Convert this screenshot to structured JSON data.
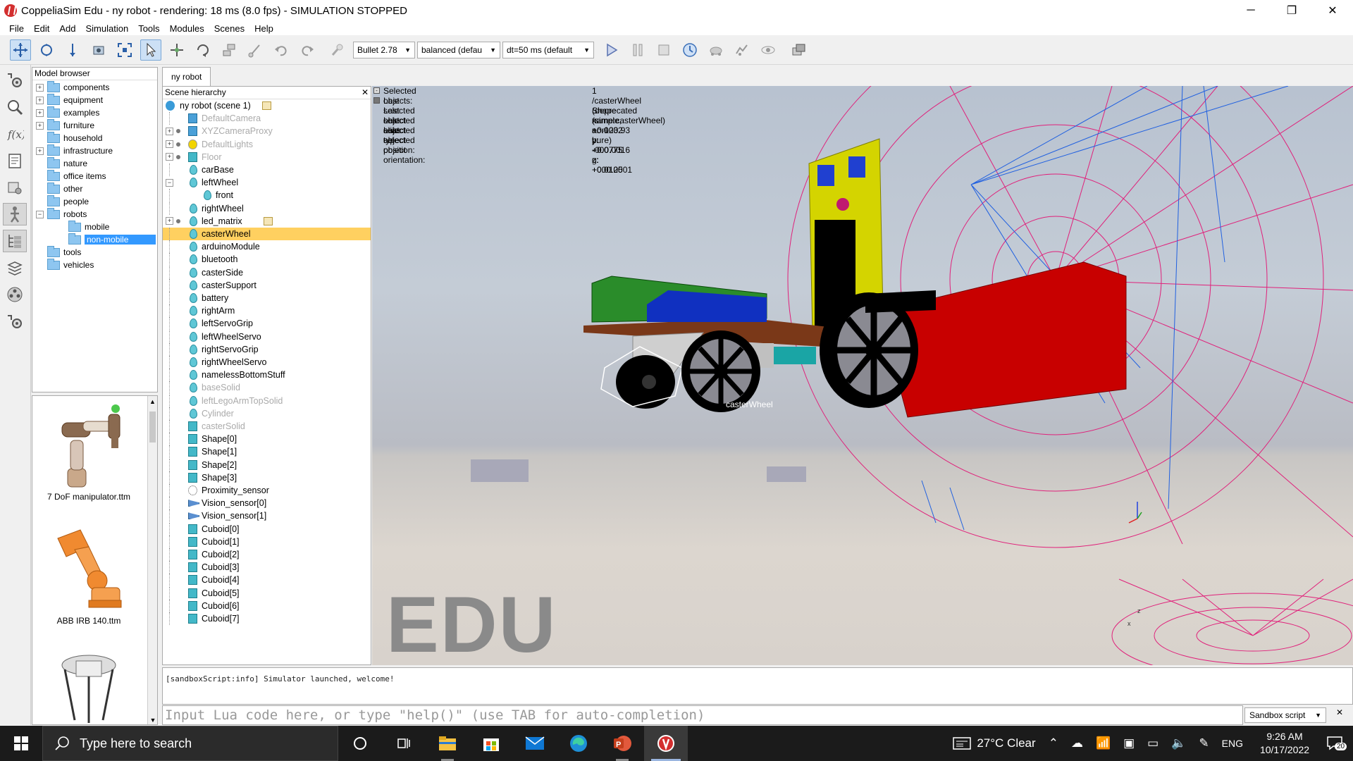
{
  "window": {
    "title": "CoppeliaSim Edu - ny robot - rendering: 18 ms (8.0 fps) - SIMULATION STOPPED",
    "minimize": "─",
    "maximize": "❐",
    "close": "✕"
  },
  "menu": [
    "File",
    "Edit",
    "Add",
    "Simulation",
    "Tools",
    "Modules",
    "Scenes",
    "Help"
  ],
  "toolbar": {
    "engine": "Bullet 2.78",
    "accuracy": "balanced (defau",
    "timestep": "dt=50 ms (default"
  },
  "model_browser": {
    "title": "Model browser",
    "folders": [
      {
        "label": "components",
        "expandable": true
      },
      {
        "label": "equipment",
        "expandable": true
      },
      {
        "label": "examples",
        "expandable": true
      },
      {
        "label": "furniture",
        "expandable": true
      },
      {
        "label": "household",
        "expandable": false
      },
      {
        "label": "infrastructure",
        "expandable": true
      },
      {
        "label": "nature",
        "expandable": false
      },
      {
        "label": "office items",
        "expandable": false
      },
      {
        "label": "other",
        "expandable": false
      },
      {
        "label": "people",
        "expandable": false
      },
      {
        "label": "robots",
        "expandable": true,
        "expanded": true
      },
      {
        "label": "mobile",
        "child": true
      },
      {
        "label": "non-mobile",
        "child": true,
        "selected": true
      },
      {
        "label": "tools",
        "expandable": false
      },
      {
        "label": "vehicles",
        "expandable": false
      }
    ],
    "models": [
      "7 DoF manipulator.ttm",
      "ABB IRB 140.ttm"
    ]
  },
  "scene_tab": "ny robot",
  "scene_hierarchy": {
    "title": "Scene hierarchy",
    "root": "ny robot (scene 1)",
    "items": [
      {
        "label": "DefaultCamera",
        "icon": "camera",
        "gray": true
      },
      {
        "label": "XYZCameraProxy",
        "icon": "camera",
        "gray": true,
        "exp": true
      },
      {
        "label": "DefaultLights",
        "icon": "light",
        "gray": true,
        "exp": true
      },
      {
        "label": "Floor",
        "icon": "cube",
        "gray": true,
        "exp": true
      },
      {
        "label": "carBase",
        "icon": "drop"
      },
      {
        "label": "leftWheel",
        "icon": "drop",
        "exp": true,
        "expanded": true
      },
      {
        "label": "front",
        "icon": "drop",
        "indent": true
      },
      {
        "label": "rightWheel",
        "icon": "drop"
      },
      {
        "label": "led_matrix",
        "icon": "drop",
        "exp": true,
        "tag": true
      },
      {
        "label": "casterWheel",
        "icon": "drop",
        "selected": true
      },
      {
        "label": "arduinoModule",
        "icon": "drop"
      },
      {
        "label": "bluetooth",
        "icon": "drop"
      },
      {
        "label": "casterSide",
        "icon": "drop"
      },
      {
        "label": "casterSupport",
        "icon": "drop"
      },
      {
        "label": "battery",
        "icon": "drop"
      },
      {
        "label": "rightArm",
        "icon": "drop"
      },
      {
        "label": "leftServoGrip",
        "icon": "drop"
      },
      {
        "label": "leftWheelServo",
        "icon": "drop"
      },
      {
        "label": "rightServoGrip",
        "icon": "drop"
      },
      {
        "label": "rightWheelServo",
        "icon": "drop"
      },
      {
        "label": "namelessBottomStuff",
        "icon": "drop"
      },
      {
        "label": "baseSolid",
        "icon": "drop",
        "gray": true
      },
      {
        "label": "leftLegoArmTopSolid",
        "icon": "drop",
        "gray": true
      },
      {
        "label": "Cylinder",
        "icon": "drop",
        "gray": true
      },
      {
        "label": "casterSolid",
        "icon": "cube",
        "gray": true
      },
      {
        "label": "Shape[0]",
        "icon": "cube"
      },
      {
        "label": "Shape[1]",
        "icon": "cube"
      },
      {
        "label": "Shape[2]",
        "icon": "cube"
      },
      {
        "label": "Shape[3]",
        "icon": "cube"
      },
      {
        "label": "Proximity_sensor",
        "icon": "sensor"
      },
      {
        "label": "Vision_sensor[0]",
        "icon": "vision"
      },
      {
        "label": "Vision_sensor[1]",
        "icon": "vision"
      },
      {
        "label": "Cuboid[0]",
        "icon": "cube"
      },
      {
        "label": "Cuboid[1]",
        "icon": "cube"
      },
      {
        "label": "Cuboid[2]",
        "icon": "cube"
      },
      {
        "label": "Cuboid[3]",
        "icon": "cube"
      },
      {
        "label": "Cuboid[4]",
        "icon": "cube"
      },
      {
        "label": "Cuboid[5]",
        "icon": "cube"
      },
      {
        "label": "Cuboid[6]",
        "icon": "cube"
      },
      {
        "label": "Cuboid[7]",
        "icon": "cube"
      }
    ]
  },
  "selection_info": {
    "rows": [
      {
        "label": "Selected objects:",
        "value": "1"
      },
      {
        "label": "Last selected object alias:",
        "value": "/casterWheel    (deprecated name:casterWheel)"
      },
      {
        "label": "Last selected object type:",
        "value": "Shape (simple, non-pure)"
      },
      {
        "label": "Last selected object position:",
        "value": "x: +0.0032    y: +0.0775    z: +0.0125"
      },
      {
        "label": "Last selected object orientation:",
        "value": "a: -120.93    b: -000.0016    g: +000.0001"
      }
    ]
  },
  "viewport": {
    "watermark": "EDU",
    "object_label": "casterWheel",
    "axis_z": "z",
    "axis_x": "x"
  },
  "console": {
    "message": "[sandboxScript:info] Simulator launched, welcome!",
    "input_placeholder": "Input Lua code here, or type \"help()\" (use TAB for auto-completion)",
    "script_select": "Sandbox script",
    "close": "✕"
  },
  "taskbar": {
    "search_placeholder": "Type here to search",
    "weather": "27°C  Clear",
    "language": "ENG",
    "time": "9:26 AM",
    "date": "10/17/2022",
    "notifications": "20"
  },
  "colors": {
    "selection_highlight": "#ffd060",
    "folder_selected": "#3399ff",
    "robot_yellow": "#d4d400",
    "robot_red": "#c80000",
    "robot_green": "#2a8c2a",
    "grid_pink": "#e0207a",
    "grid_blue": "#2060e0"
  }
}
